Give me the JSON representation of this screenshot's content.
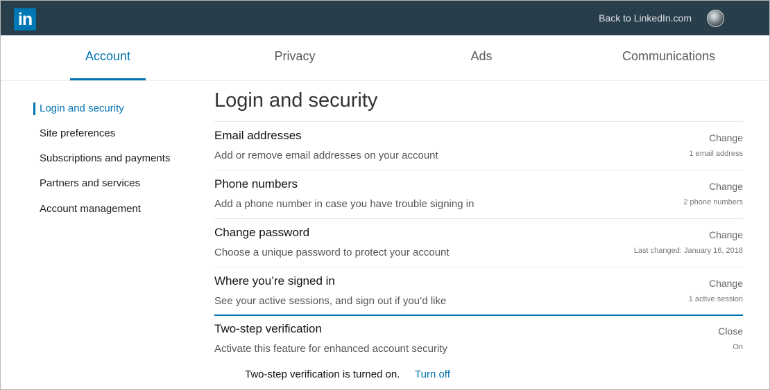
{
  "header": {
    "logo_text": "in",
    "back_link": "Back to LinkedIn.com"
  },
  "tabs": [
    {
      "label": "Account",
      "active": true
    },
    {
      "label": "Privacy",
      "active": false
    },
    {
      "label": "Ads",
      "active": false
    },
    {
      "label": "Communications",
      "active": false
    }
  ],
  "sidebar": {
    "items": [
      {
        "label": "Login and security",
        "active": true
      },
      {
        "label": "Site preferences",
        "active": false
      },
      {
        "label": "Subscriptions and payments",
        "active": false
      },
      {
        "label": "Partners and services",
        "active": false
      },
      {
        "label": "Account management",
        "active": false
      }
    ]
  },
  "main": {
    "title": "Login and security",
    "rows": [
      {
        "title": "Email addresses",
        "description": "Add or remove email addresses on your account",
        "action": "Change",
        "meta": "1 email address"
      },
      {
        "title": "Phone numbers",
        "description": "Add a phone number in case you have trouble signing in",
        "action": "Change",
        "meta": "2 phone numbers"
      },
      {
        "title": "Change password",
        "description": "Choose a unique password to protect your account",
        "action": "Change",
        "meta": "Last changed: January 16, 2018"
      },
      {
        "title": "Where you’re signed in",
        "description": "See your active sessions, and sign out if you’d like",
        "action": "Change",
        "meta": "1 active session"
      },
      {
        "title": "Two-step verification",
        "description": "Activate this feature for enhanced account security",
        "action": "Close",
        "meta": "On"
      }
    ],
    "two_step": {
      "status": "Two-step verification is turned on.",
      "turn_off": "Turn off"
    }
  },
  "colors": {
    "topbar": "#283e4a",
    "accent": "#0073b1",
    "logo": "#0077b5"
  }
}
